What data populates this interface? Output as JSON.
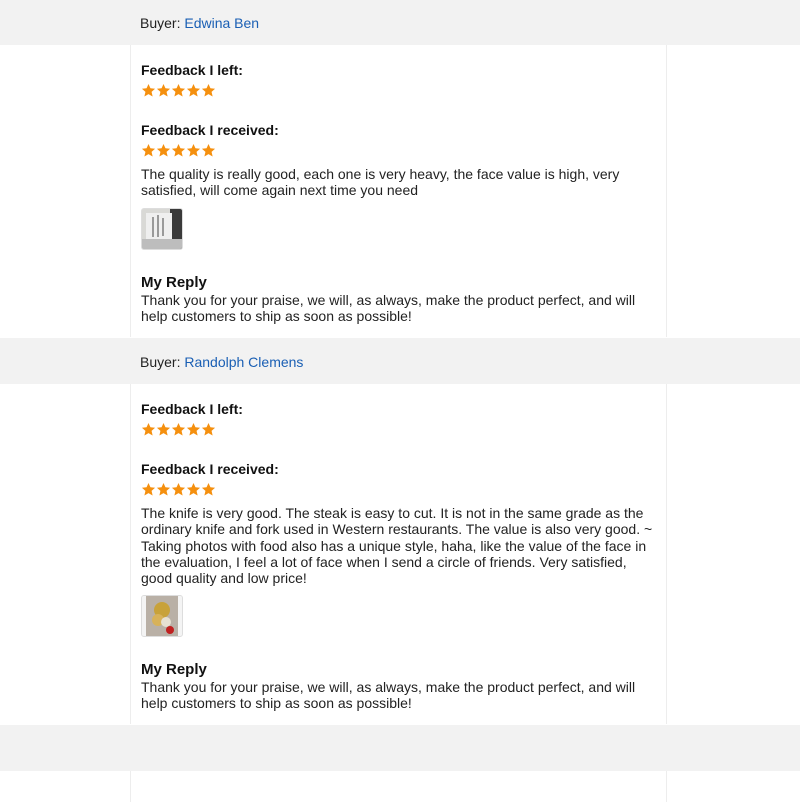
{
  "reviews": [
    {
      "buyer_prefix": "Buyer:",
      "buyer_name": "Edwina Ben",
      "feedback_left_label": "Feedback I left:",
      "feedback_left_rating": 5,
      "feedback_received_label": "Feedback I received:",
      "feedback_received_rating": 5,
      "review_text": "The quality is really good, each one is very heavy, the face value is high, very satisfied, will come again next time you need",
      "reply_title": "My Reply",
      "reply_text": "Thank you for your praise, we will, as always, make the product perfect, and will help customers to ship as soon as possible!"
    },
    {
      "buyer_prefix": "Buyer:",
      "buyer_name": "Randolph Clemens",
      "feedback_left_label": "Feedback I left:",
      "feedback_left_rating": 5,
      "feedback_received_label": "Feedback I received:",
      "feedback_received_rating": 5,
      "review_text": "The knife is very good. The steak is easy to cut. It is not in the same grade as the ordinary knife and fork used in Western restaurants. The value is also very good. ~ Taking photos with food also has a unique style, haha, like the value of the face in the evaluation, I feel a lot of face when I send a circle of friends. Very satisfied, good quality and low price!",
      "reply_title": "My Reply",
      "reply_text": "Thank you for your praise, we will, as always, make the product perfect, and will help customers to ship as soon as possible!"
    }
  ],
  "colors": {
    "star": "#f5900f",
    "buyer_link": "#1a5fb4",
    "band": "#f2f2f2"
  },
  "icons": {
    "star": "star-icon"
  }
}
